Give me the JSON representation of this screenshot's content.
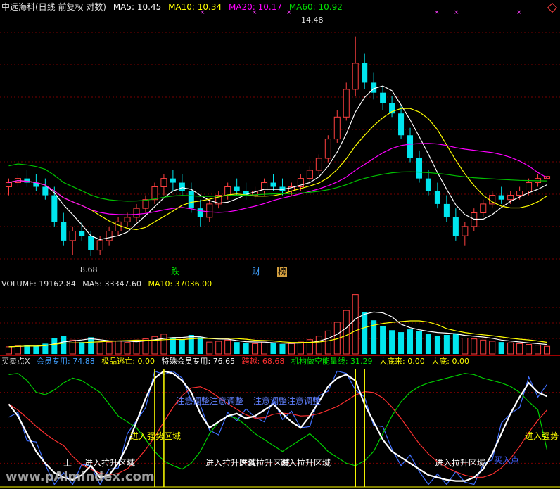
{
  "price_header": {
    "title": "中远海科(日线 前复权 对数)",
    "ma5": "MA5: 10.45",
    "ma10": "MA10: 10.34",
    "ma20": "MA20: 10.17",
    "ma60": "MA60: 10.92"
  },
  "price_annotations": {
    "high": "14.48",
    "low": "8.68",
    "tag_die": "跌",
    "tag_cai": "财",
    "tag_bang": "榜"
  },
  "volume_header": {
    "volume": "VOLUME: 19162.84",
    "ma5": "MA5: 33347.60",
    "ma10": "MA10: 37036.00"
  },
  "indicator_header": {
    "name": "买卖点X",
    "member": "会员专用: 74.88",
    "escape": "极品逃亡: 0.00",
    "special": "特殊会员专用: 76.65",
    "cross": "跨越: 68.68",
    "inst": "机构做空能量线: 31.29",
    "bottom": "大底来: 0.00",
    "big_bottom": "大底: 0.00"
  },
  "indicator_labels": {
    "adjust1": "注意调整注意调整",
    "adjust2": "注意调整注意调整",
    "strong1": "进入强势区域",
    "strong2": "进入强势",
    "rise_a": "进入拉升区域",
    "rise_b": "进入拉升区域",
    "rise_c": "进入拉升区域",
    "rise_d": "进入拉升区域",
    "buy1": "上",
    "buy2": "进入拉升区域",
    "buy_point": "买入点",
    "watermark": "www.pAlmindex.com"
  },
  "colors": {
    "up": "#ff4040",
    "down": "#00e5ee",
    "ma5": "#ffffff",
    "ma10": "#ffff00",
    "ma20": "#ff00ff",
    "ma60": "#00c000"
  },
  "chart_data": {
    "type": "candlestick",
    "scale": "log",
    "ylim": [
      8.4,
      15.2
    ],
    "candles": [
      [
        10.2,
        10.4,
        10.0,
        10.3
      ],
      [
        10.3,
        10.5,
        10.2,
        10.4
      ],
      [
        10.4,
        10.6,
        10.2,
        10.3
      ],
      [
        10.3,
        10.5,
        10.1,
        10.2
      ],
      [
        10.2,
        10.4,
        9.9,
        10.0
      ],
      [
        10.0,
        10.2,
        9.3,
        9.4
      ],
      [
        9.4,
        9.6,
        8.9,
        9.0
      ],
      [
        9.0,
        9.3,
        8.7,
        9.2
      ],
      [
        9.2,
        9.4,
        9.0,
        9.1
      ],
      [
        9.1,
        9.2,
        8.68,
        8.8
      ],
      [
        8.8,
        9.1,
        8.7,
        9.0
      ],
      [
        9.0,
        9.3,
        8.9,
        9.2
      ],
      [
        9.2,
        9.5,
        9.1,
        9.4
      ],
      [
        9.4,
        9.6,
        9.3,
        9.5
      ],
      [
        9.5,
        9.8,
        9.4,
        9.7
      ],
      [
        9.7,
        10.0,
        9.6,
        9.9
      ],
      [
        9.9,
        10.3,
        9.8,
        10.2
      ],
      [
        10.2,
        10.5,
        10.0,
        10.4
      ],
      [
        10.4,
        10.6,
        10.1,
        10.3
      ],
      [
        10.3,
        10.5,
        10.0,
        10.1
      ],
      [
        10.1,
        10.3,
        9.6,
        9.7
      ],
      [
        9.7,
        9.9,
        9.3,
        9.5
      ],
      [
        9.5,
        9.9,
        9.4,
        9.8
      ],
      [
        9.8,
        10.1,
        9.7,
        10.0
      ],
      [
        10.0,
        10.3,
        9.9,
        10.2
      ],
      [
        10.2,
        10.4,
        10.0,
        10.1
      ],
      [
        10.1,
        10.3,
        9.9,
        10.0
      ],
      [
        10.0,
        10.2,
        9.9,
        10.1
      ],
      [
        10.1,
        10.4,
        10.0,
        10.3
      ],
      [
        10.3,
        10.5,
        10.1,
        10.2
      ],
      [
        10.2,
        10.4,
        10.0,
        10.1
      ],
      [
        10.1,
        10.3,
        10.0,
        10.2
      ],
      [
        10.2,
        10.5,
        10.1,
        10.4
      ],
      [
        10.4,
        10.7,
        10.3,
        10.6
      ],
      [
        10.6,
        11.0,
        10.5,
        10.9
      ],
      [
        10.9,
        11.5,
        10.8,
        11.4
      ],
      [
        11.4,
        12.2,
        11.3,
        12.0
      ],
      [
        12.0,
        13.0,
        11.9,
        12.8
      ],
      [
        12.8,
        14.48,
        12.6,
        13.6
      ],
      [
        13.6,
        13.9,
        12.8,
        13.0
      ],
      [
        13.0,
        13.3,
        12.5,
        12.7
      ],
      [
        12.7,
        12.9,
        12.2,
        12.4
      ],
      [
        12.4,
        12.6,
        12.0,
        12.1
      ],
      [
        12.1,
        12.3,
        11.4,
        11.5
      ],
      [
        11.5,
        11.7,
        10.8,
        10.9
      ],
      [
        10.9,
        11.1,
        10.3,
        10.4
      ],
      [
        10.4,
        10.6,
        10.0,
        10.1
      ],
      [
        10.1,
        10.3,
        9.7,
        9.8
      ],
      [
        9.8,
        10.0,
        9.4,
        9.5
      ],
      [
        9.5,
        9.7,
        9.0,
        9.1
      ],
      [
        9.1,
        9.4,
        8.9,
        9.3
      ],
      [
        9.3,
        9.7,
        9.2,
        9.6
      ],
      [
        9.6,
        9.9,
        9.5,
        9.8
      ],
      [
        9.8,
        10.1,
        9.7,
        10.0
      ],
      [
        10.0,
        10.2,
        9.8,
        9.9
      ],
      [
        9.9,
        10.1,
        9.8,
        10.0
      ],
      [
        10.0,
        10.2,
        9.9,
        10.1
      ],
      [
        10.1,
        10.4,
        10.0,
        10.3
      ],
      [
        10.3,
        10.5,
        10.2,
        10.4
      ],
      [
        10.4,
        10.6,
        10.3,
        10.45
      ]
    ],
    "volume": [
      18000,
      20000,
      22000,
      19000,
      26000,
      40000,
      45000,
      35000,
      30000,
      42000,
      28000,
      30000,
      33000,
      29000,
      35000,
      38000,
      44000,
      50000,
      40000,
      36000,
      48000,
      42000,
      30000,
      32000,
      35000,
      30000,
      28000,
      26000,
      30000,
      27000,
      25000,
      26000,
      30000,
      36000,
      45000,
      58000,
      80000,
      110000,
      150000,
      105000,
      85000,
      70000,
      60000,
      55000,
      62000,
      58000,
      50000,
      45000,
      48000,
      52000,
      40000,
      38000,
      35000,
      32000,
      30000,
      28000,
      26000,
      24000,
      22000,
      19162
    ],
    "vol_ylim": [
      0,
      160000
    ]
  }
}
